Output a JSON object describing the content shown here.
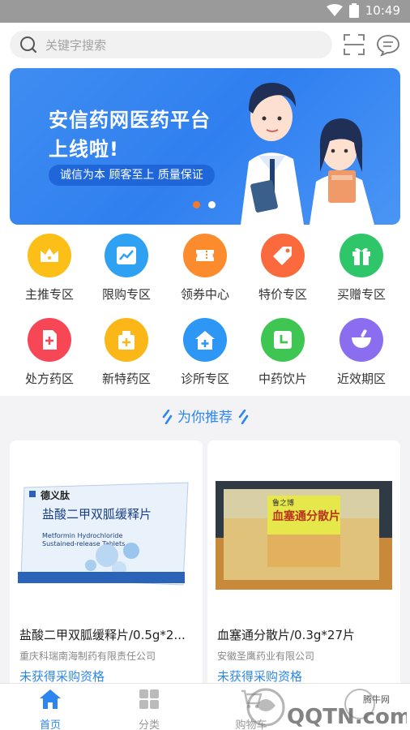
{
  "status_bar": {
    "time": "10:49"
  },
  "search": {
    "placeholder": "关键字搜索"
  },
  "banner": {
    "title_line1": "安信药网医药平台",
    "title_line2": "上线啦!",
    "slogan": "诚信为本 顾客至上 质量保证",
    "slide_count": 2,
    "active_slide": 1,
    "colors": {
      "background": "#2f7ff0",
      "active_dot": "#f47a2c"
    }
  },
  "categories": [
    {
      "label": "主推专区",
      "icon": "crown-icon",
      "color": "#fbbf17"
    },
    {
      "label": "限购专区",
      "icon": "trend-chart-icon",
      "color": "#2ea1f2"
    },
    {
      "label": "领券中心",
      "icon": "coupon-icon",
      "color": "#fb8b2c"
    },
    {
      "label": "特价专区",
      "icon": "price-tag-icon",
      "color": "#fb6a3c"
    },
    {
      "label": "买赠专区",
      "icon": "gift-icon",
      "color": "#2fc66a"
    },
    {
      "label": "处方药区",
      "icon": "prescription-icon",
      "color": "#f74757"
    },
    {
      "label": "新特药区",
      "icon": "medicine-box-icon",
      "color": "#fbb717"
    },
    {
      "label": "诊所专区",
      "icon": "clinic-icon",
      "color": "#2e96f4"
    },
    {
      "label": "中药饮片",
      "icon": "herbal-clock-icon",
      "color": "#3ec552"
    },
    {
      "label": "近效期区",
      "icon": "mortar-icon",
      "color": "#8b6df0"
    }
  ],
  "recommend": {
    "title": "为你推荐",
    "accent": "#2d86f0"
  },
  "products": [
    {
      "name": "盐酸二甲双胍缓释片/0.5g*2...",
      "company": "重庆科瑞南海制药有限责任公司",
      "status": "未获得采购资格",
      "image": {
        "box_brand": "德义肽",
        "box_title": "盐酸二甲双胍缓释片",
        "box_english_line1": "Metformin Hydrochloride",
        "box_english_line2": "Sustained-release Tablets"
      }
    },
    {
      "name": "血塞通分散片/0.3g*27片",
      "company": "安徽圣鹰药业有限公司",
      "status": "未获得采购资格",
      "image": {
        "box_brand": "鲁之博",
        "box_title": "血塞通分散片"
      }
    }
  ],
  "tabs": [
    {
      "label": "首页",
      "icon": "home-icon",
      "active": true
    },
    {
      "label": "分类",
      "icon": "category-grid-icon",
      "active": false
    },
    {
      "label": "购物车",
      "icon": "cart-icon",
      "active": false
    }
  ],
  "watermark": {
    "text_small": "腾牛网",
    "text_large": "QQTN.com"
  }
}
